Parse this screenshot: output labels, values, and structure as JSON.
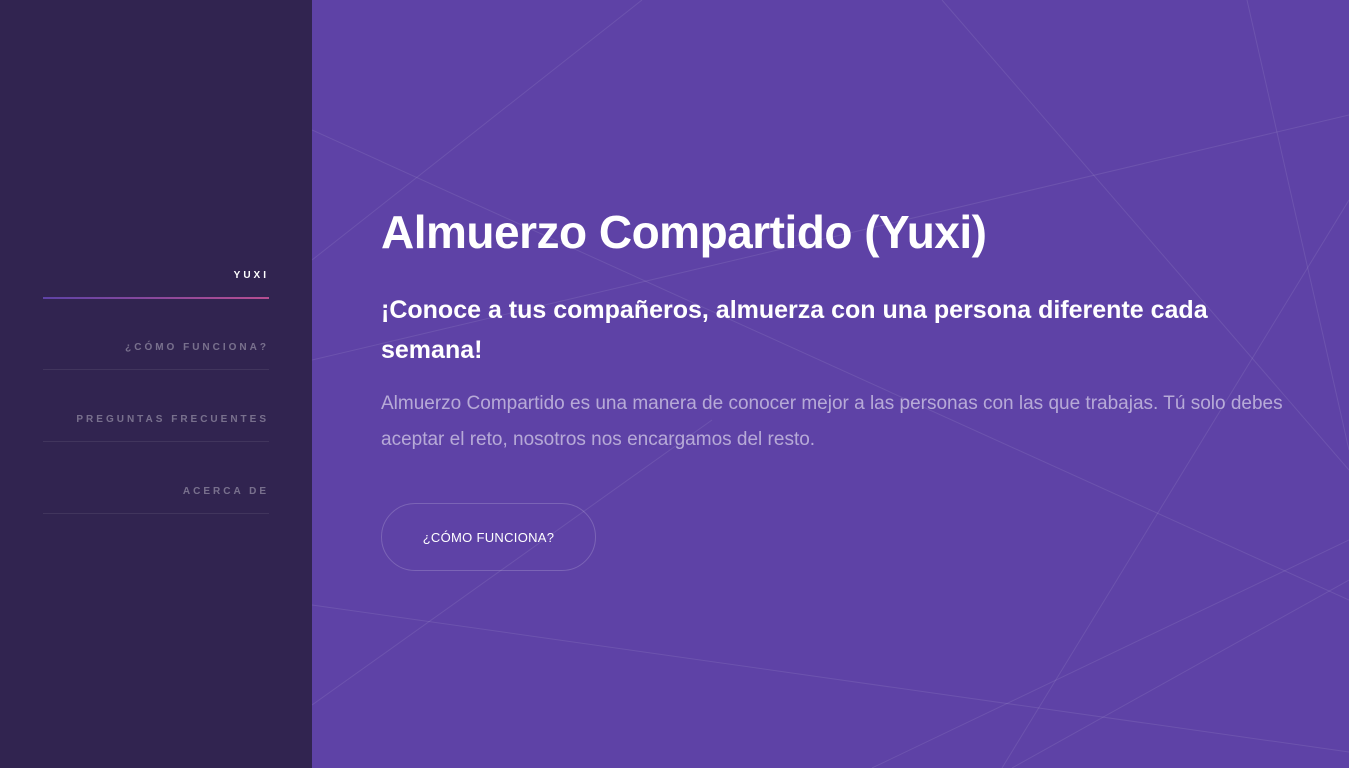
{
  "sidebar": {
    "items": [
      {
        "label": "Yuxi",
        "active": true
      },
      {
        "label": "¿Cómo funciona?",
        "active": false
      },
      {
        "label": "Preguntas frecuentes",
        "active": false
      },
      {
        "label": "Acerca de",
        "active": false
      }
    ]
  },
  "hero": {
    "title": "Almuerzo Compartido (Yuxi)",
    "subtitle": "¡Conoce a tus compañeros, almuerza con una persona diferente cada semana!",
    "description": "Almuerzo Compartido es una manera de conocer mejor a las personas con las que trabajas. Tú solo debes aceptar el reto, nosotros nos encargamos del resto.",
    "cta_label": "¿CÓMO FUNCIONA?"
  },
  "colors": {
    "sidebar_bg": "#312450",
    "main_bg": "#5e42a6",
    "accent_gradient_start": "#5e42a6",
    "accent_gradient_end": "#b74e91"
  }
}
